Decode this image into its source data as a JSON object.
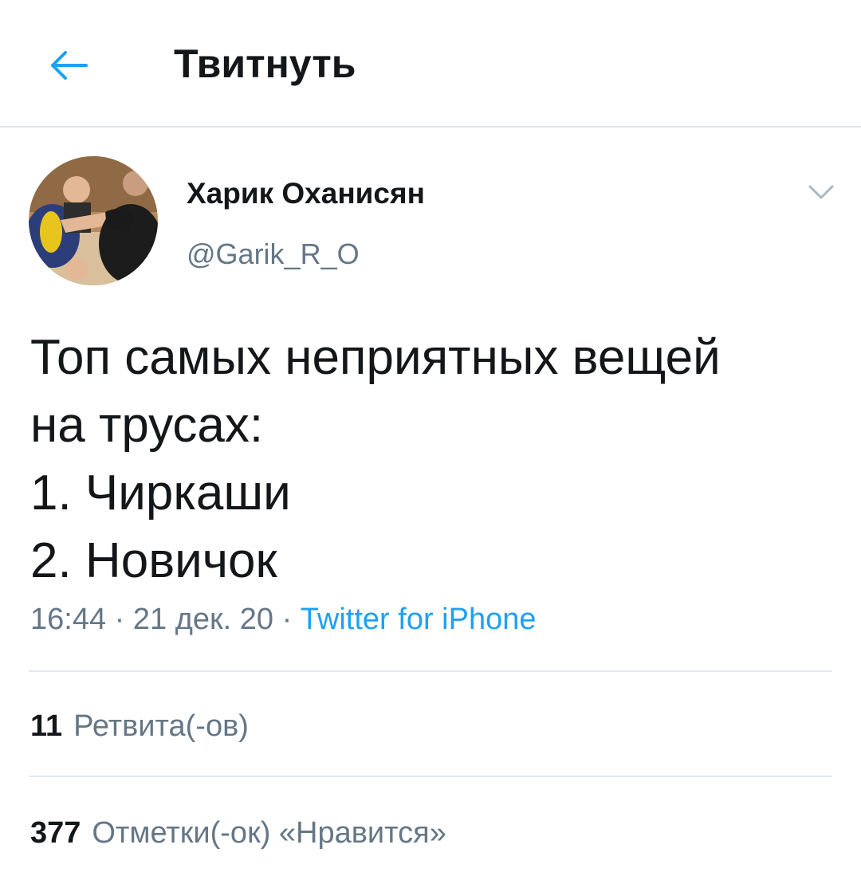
{
  "header": {
    "title": "Твитнуть",
    "back_icon": "arrow-left-icon",
    "accent_color": "#1da1f2"
  },
  "author": {
    "name": "Харик Оханисян",
    "handle": "@Garik_R_O",
    "menu_icon": "chevron-down-icon"
  },
  "tweet": {
    "lines": [
      "Топ самых неприятных вещей",
      "на трусах:",
      "1. Чиркаши",
      "2. Новичок"
    ]
  },
  "meta": {
    "time": "16:44",
    "separator": "·",
    "date": "21 дек. 20",
    "source": "Twitter for iPhone"
  },
  "stats": {
    "retweets": {
      "count": "11",
      "label": "Ретвита(-ов)"
    },
    "likes": {
      "count": "377",
      "label": "Отметки(-ок) «Нравится»"
    }
  }
}
